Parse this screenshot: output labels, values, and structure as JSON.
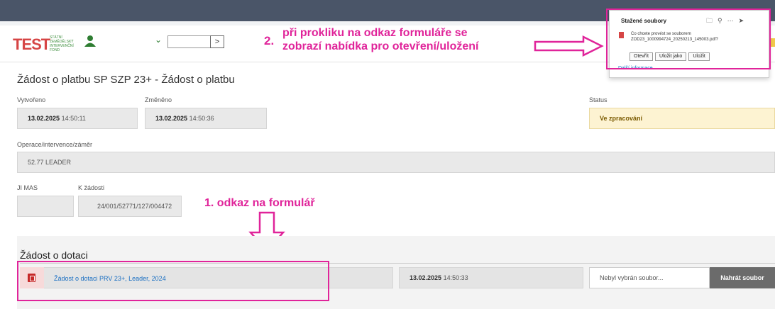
{
  "header": {
    "logo_text": "TEST",
    "logo_sub": "STÁTNÍ ZEMĚDĚLSKÝ INTERVENČNÍ FOND",
    "goto_button": ">"
  },
  "annotation2": {
    "number": "2.",
    "line1": "při prokliku na odkaz formuláře se",
    "line2": "zobrazí nabídka pro otevření/uložení"
  },
  "annotation1": {
    "text": "1. odkaz na formulář"
  },
  "downloads_popup": {
    "title": "Stažené soubory",
    "question_line1": "Co chcete provést se souborem",
    "question_line2": "ZOD23_1000994724_20250213_145003.pdf?",
    "open_label": "Otevřít",
    "save_as_label": "Uložit jako",
    "save_label": "Uložit",
    "more_info": "Další informace"
  },
  "page": {
    "title": "Žádost o platbu SP SZP 23+ - Žádost o platbu",
    "created_label": "Vytvořeno",
    "created_date": "13.02.2025",
    "created_time": "14:50:11",
    "changed_label": "Změněno",
    "changed_date": "13.02.2025",
    "changed_time": "14:50:36",
    "status_label": "Status",
    "status_value": "Ve zpracování",
    "operation_label": "Operace/intervence/záměr",
    "operation_value": "52.77 LEADER",
    "jimas_label": "JI MAS",
    "request_label": "K žádosti",
    "request_value": "24/001/52771/127/004472"
  },
  "section": {
    "title": "Žádost o dotaci",
    "form_link": "Žádost o dotaci PRV 23+, Leader, 2024",
    "form_date": "13.02.2025",
    "form_time": "14:50:33",
    "file_placeholder": "Nebyl vybrán soubor...",
    "upload_label": "Nahrát soubor"
  },
  "colors": {
    "annotation": "#e0249a",
    "topbar": "#4a5568",
    "status_bg": "#fdf3d2",
    "upload_btn": "#6b6b6b",
    "link": "#1a6fc2"
  }
}
